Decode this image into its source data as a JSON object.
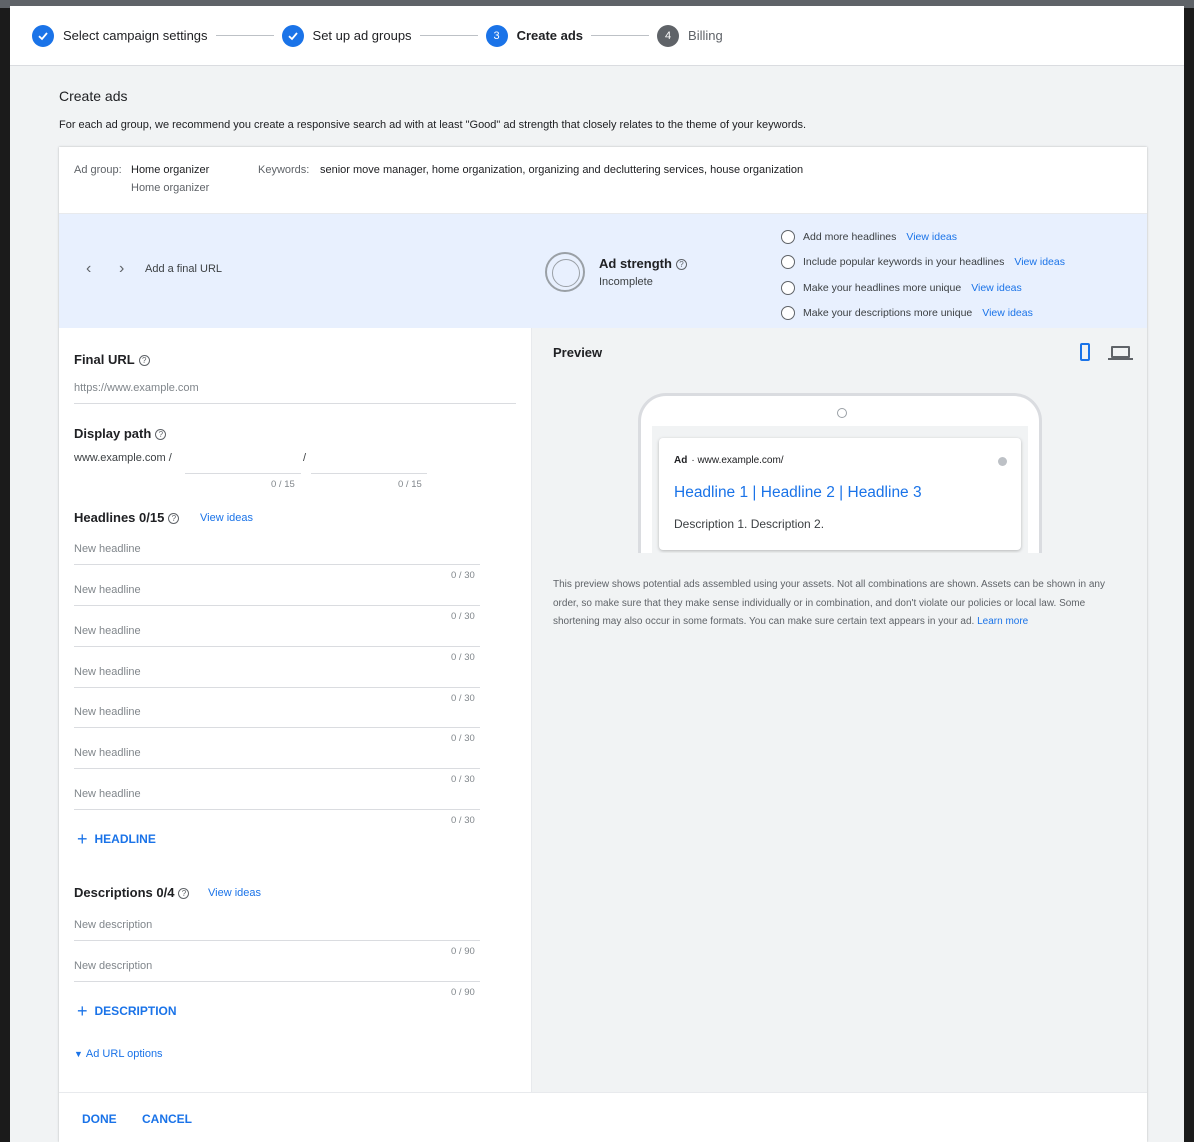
{
  "stepper": {
    "steps": [
      {
        "label": "Select campaign settings",
        "status": "done"
      },
      {
        "label": "Set up ad groups",
        "status": "done"
      },
      {
        "label": "Create ads",
        "status": "active",
        "number": "3"
      },
      {
        "label": "Billing",
        "status": "pending",
        "number": "4"
      }
    ]
  },
  "header": {
    "title": "Create ads",
    "description": "For each ad group, we recommend you create a responsive search ad with at least \"Good\" ad strength that closely relates to the theme of your keywords."
  },
  "ad_group": {
    "label": "Ad group:",
    "name": "Home organizer",
    "sub_name": "Home organizer",
    "keywords_label": "Keywords:",
    "keywords": "senior move manager, home organization, organizing and decluttering services, house organization"
  },
  "strength": {
    "final_url_hint": "Add a final URL",
    "title": "Ad strength",
    "status": "Incomplete",
    "tips": [
      {
        "text": "Add more headlines",
        "link": "View ideas"
      },
      {
        "text": "Include popular keywords in your headlines",
        "link": "View ideas"
      },
      {
        "text": "Make your headlines more unique",
        "link": "View ideas"
      },
      {
        "text": "Make your descriptions more unique",
        "link": "View ideas"
      }
    ]
  },
  "form": {
    "final_url_label": "Final URL",
    "final_url_placeholder": "https://www.example.com",
    "display_path_label": "Display path",
    "display_path_prefix": "www.example.com /",
    "display_path_sep": "/",
    "path_counter": "0 / 15",
    "headlines_label": "Headlines 0/15",
    "headlines_view_ideas": "View ideas",
    "headline_placeholder": "New headline",
    "headline_counter": "0 / 30",
    "add_headline": "HEADLINE",
    "descriptions_label": "Descriptions 0/4",
    "descriptions_view_ideas": "View ideas",
    "description_placeholder": "New description",
    "description_counter": "0 / 90",
    "add_description": "DESCRIPTION",
    "url_options": "Ad URL options"
  },
  "preview": {
    "title": "Preview",
    "ad_badge": "Ad",
    "ad_url": "· www.example.com/",
    "headline": "Headline 1 | Headline 2 | Headline 3",
    "description": "Description 1. Description 2.",
    "note": "This preview shows potential ads assembled using your assets. Not all combinations are shown. Assets can be shown in any order, so make sure that they make sense individually or in combination, and don't violate our policies or local law. Some shortening may also occur in some formats. You can make sure certain text appears in your ad.",
    "learn_more": "Learn more"
  },
  "footer": {
    "done": "DONE",
    "cancel": "CANCEL"
  },
  "colors": {
    "accent": "#1a73e8",
    "band": "#e8f0fe"
  }
}
